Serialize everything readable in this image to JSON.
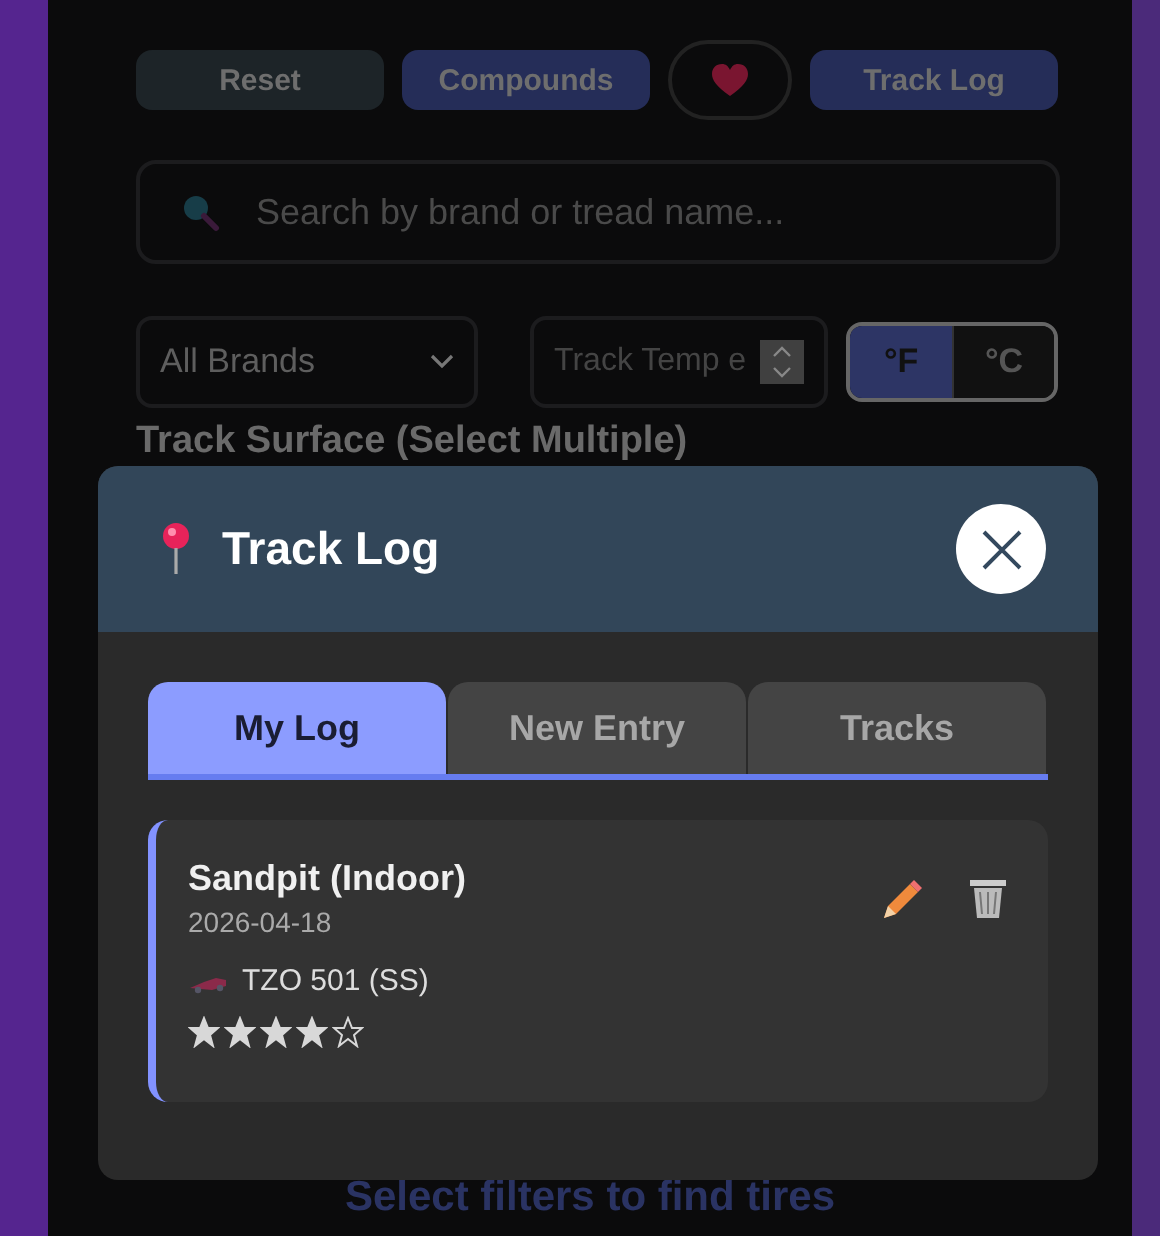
{
  "toolbar": [
    {
      "kind": "plain",
      "label": "Reset"
    },
    {
      "kind": "primary",
      "label": "Compounds"
    },
    {
      "kind": "heart"
    },
    {
      "kind": "primary",
      "label": "Track Log"
    }
  ],
  "search": {
    "placeholder": "Search by brand or tread name..."
  },
  "brand_select": {
    "value": "All Brands"
  },
  "track_temp": {
    "placeholder": "Track Temp e"
  },
  "unit_toggle": [
    {
      "label": "°F",
      "selected": true
    },
    {
      "label": "°C",
      "selected": false
    }
  ],
  "surface_label": "Track Surface (Select Multiple)",
  "empty_message": "Select filters to find tires",
  "modal": {
    "title": "Track Log",
    "tabs": [
      {
        "label": "My Log",
        "selected": true
      },
      {
        "label": "New Entry",
        "selected": false
      },
      {
        "label": "Tracks",
        "selected": false
      }
    ],
    "entries": [
      {
        "track": "Sandpit (Indoor)",
        "date": "2026-04-18",
        "tire": "TZO 501 (SS)",
        "stars": 4
      }
    ]
  }
}
